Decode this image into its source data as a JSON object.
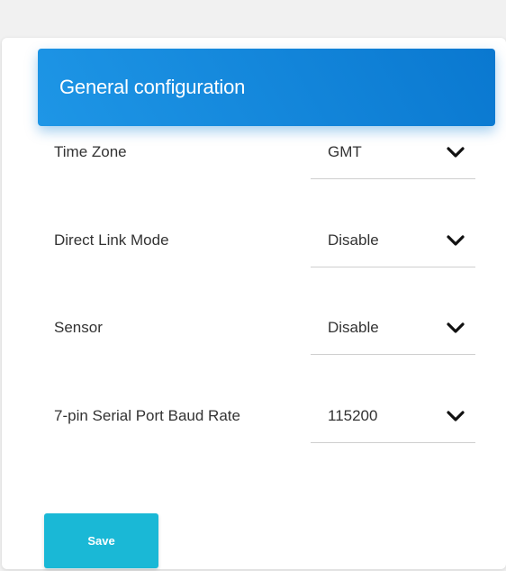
{
  "header": {
    "title": "General configuration"
  },
  "fields": [
    {
      "label": "Time Zone",
      "value": "GMT",
      "icon": "chevron-down-icon"
    },
    {
      "label": "Direct Link Mode",
      "value": "Disable",
      "icon": "chevron-down-icon"
    },
    {
      "label": "Sensor",
      "value": "Disable",
      "icon": "chevron-down-icon"
    },
    {
      "label": "7-pin Serial Port Baud Rate",
      "value": "115200",
      "icon": "chevron-down-icon"
    }
  ],
  "actions": {
    "save_label": "Save"
  },
  "colors": {
    "header_start": "#1e96e6",
    "header_end": "#0a78d0",
    "save_button": "#1ab8d6"
  }
}
